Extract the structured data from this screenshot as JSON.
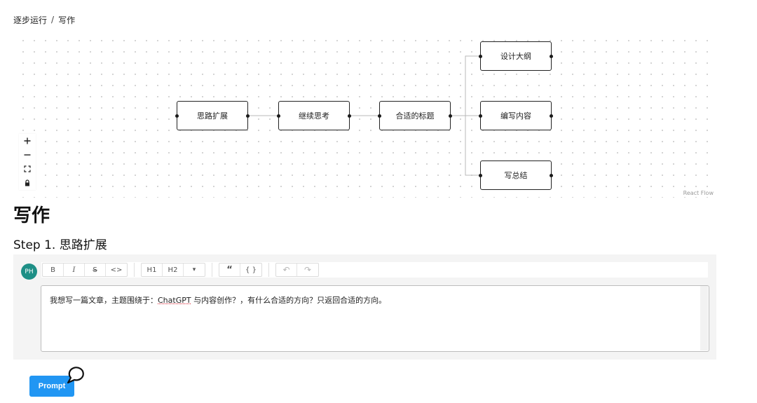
{
  "breadcrumb": {
    "items": [
      "逐步运行",
      "写作"
    ],
    "separator": "/"
  },
  "flow": {
    "nodes": [
      {
        "id": "n1",
        "label": "思路扩展"
      },
      {
        "id": "n2",
        "label": "继续思考"
      },
      {
        "id": "n3",
        "label": "合适的标题"
      },
      {
        "id": "n4",
        "label": "设计大纲"
      },
      {
        "id": "n5",
        "label": "编写内容"
      },
      {
        "id": "n6",
        "label": "写总结"
      }
    ],
    "controls": [
      "zoom-in",
      "zoom-out",
      "fit-view",
      "lock"
    ],
    "attribution": "React Flow"
  },
  "page": {
    "title": "写作",
    "step_title": "Step 1. 思路扩展"
  },
  "editor": {
    "avatar_initials": "PH",
    "avatar_color": "#1e8f86",
    "toolbar": {
      "bold": "B",
      "italic": "I",
      "strike": "S",
      "code": "<>",
      "h1": "H1",
      "h2": "H2",
      "more": "▾",
      "quote": "“",
      "code_block": "{ }",
      "undo": "↶",
      "redo": "↷"
    },
    "content_before": "我想写一篇文章，主题围绕于：",
    "content_highlight": "ChatGPT",
    "content_after": " 与内容创作？，有什么合适的方向？只返回合适的方向。"
  },
  "actions": {
    "prompt_label": "Prompt",
    "prompt_color": "#2196f3"
  }
}
